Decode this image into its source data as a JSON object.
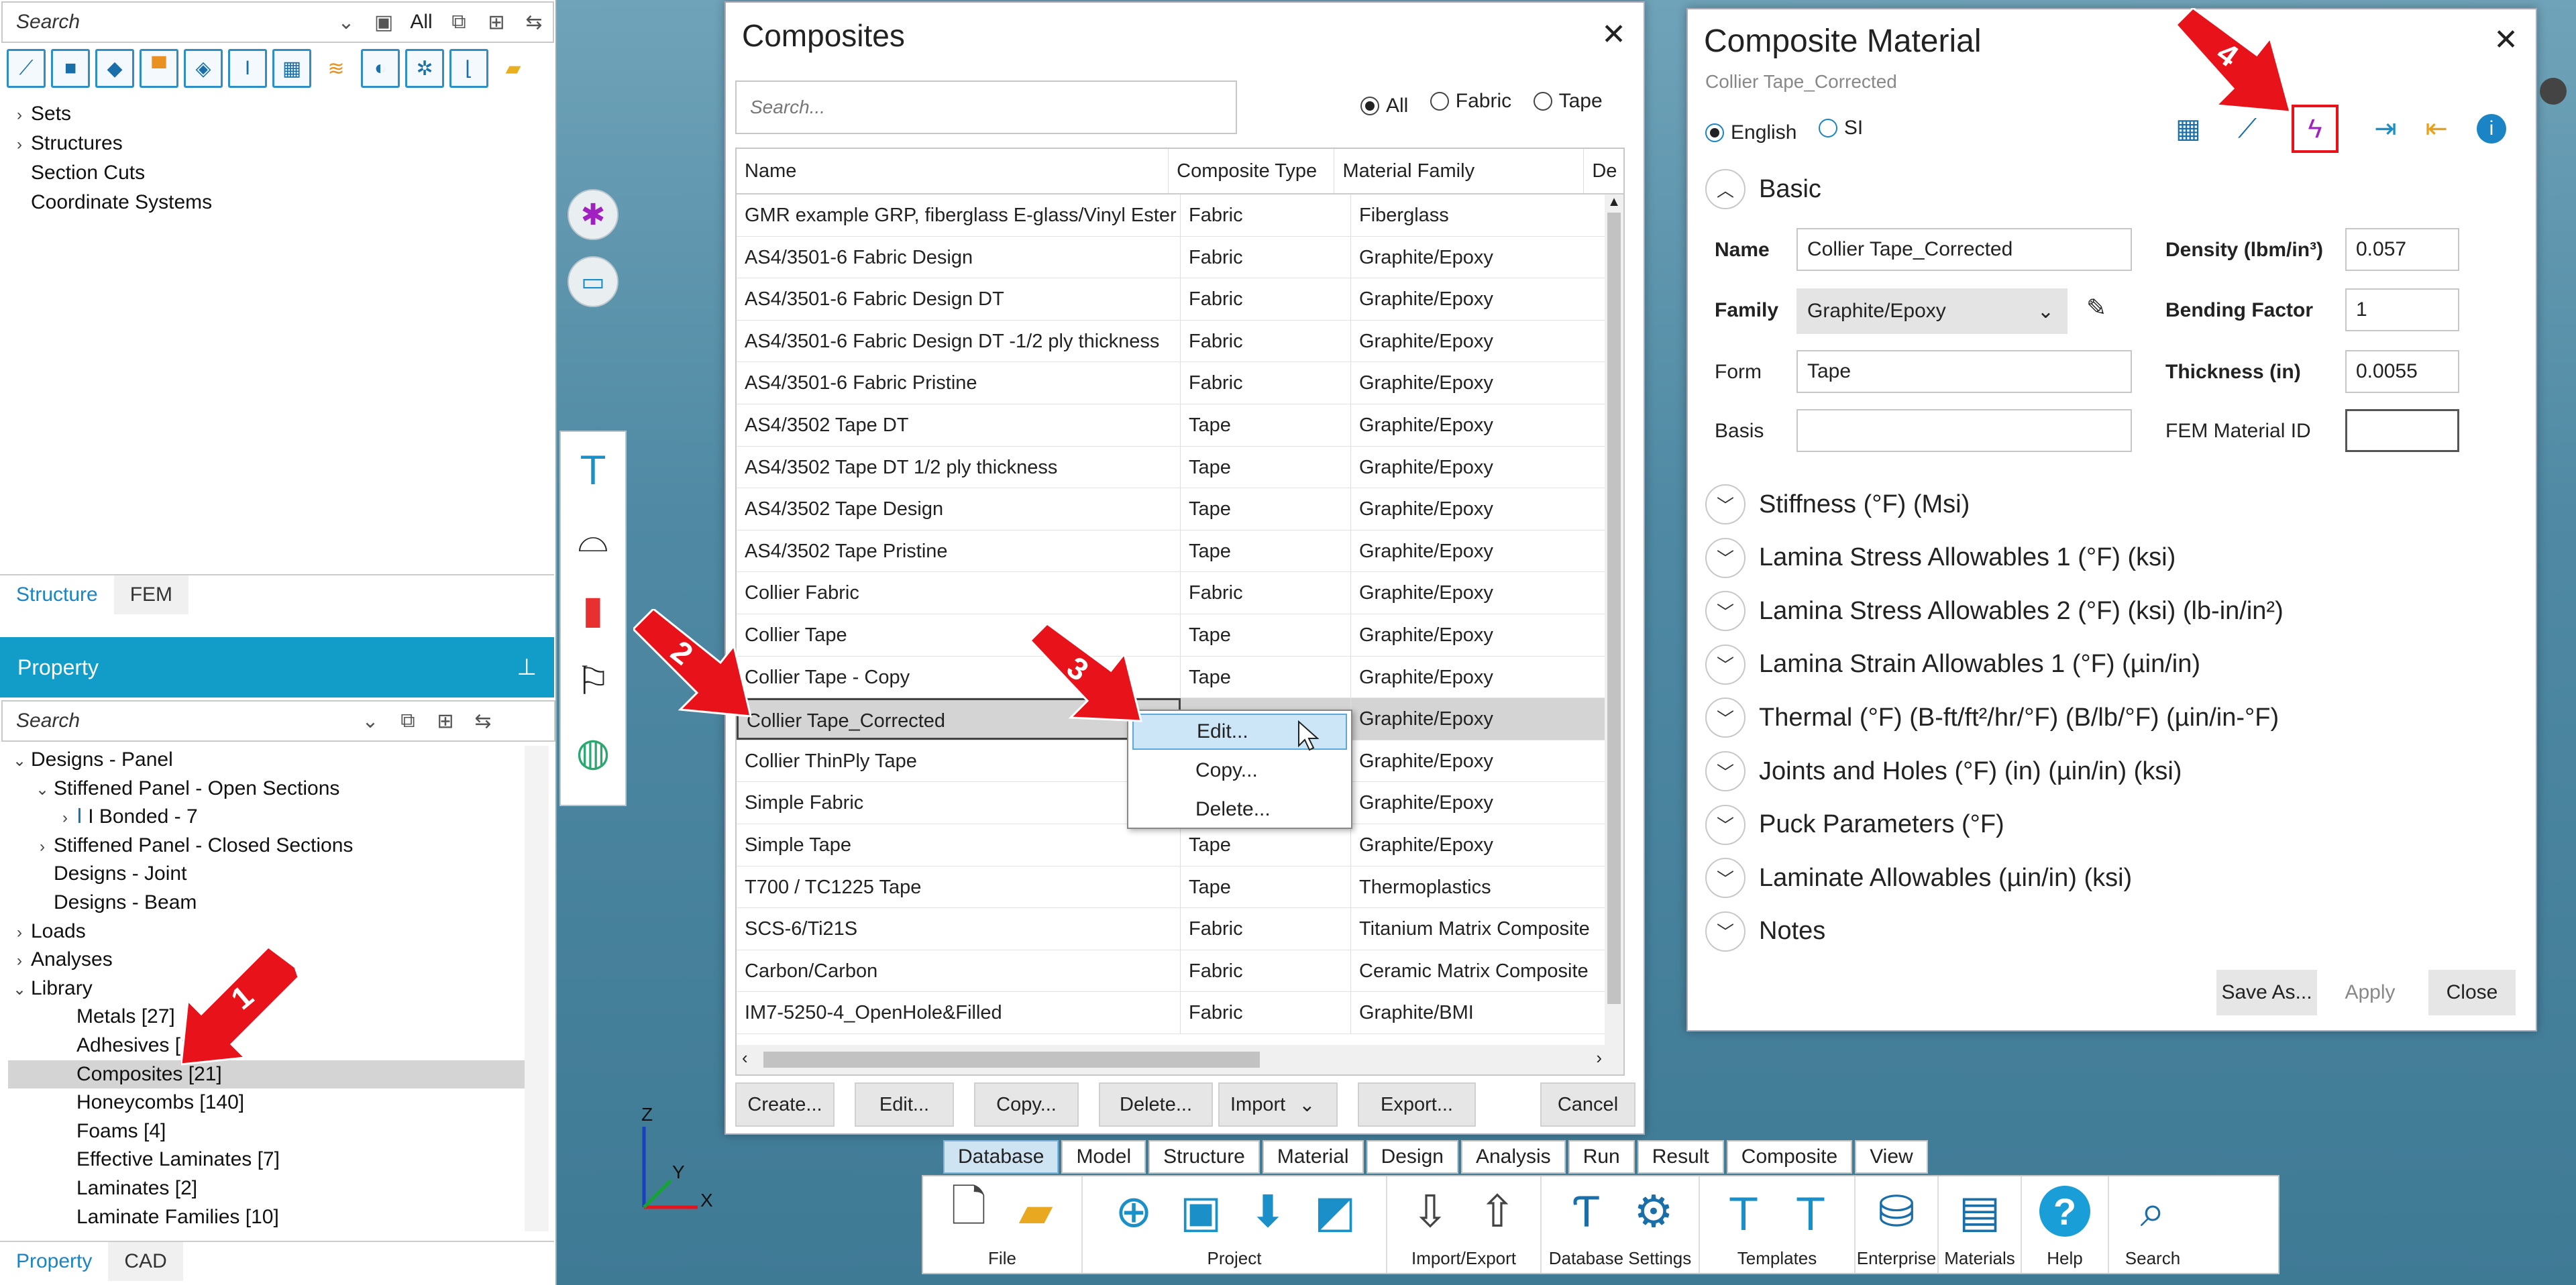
{
  "left_panel": {
    "search_placeholder": "Search",
    "filter_all": "All",
    "tree_top": [
      "Sets",
      "Structures",
      "Section Cuts",
      "Coordinate Systems"
    ],
    "tabs_top": [
      "Structure",
      "FEM"
    ],
    "property_title": "Property",
    "property_search": "Search",
    "property_tree": [
      {
        "label": "Designs - Panel",
        "indent": 0,
        "caret": "⌄"
      },
      {
        "label": "Stiffened Panel - Open Sections",
        "indent": 1,
        "caret": "⌄"
      },
      {
        "label": "I Bonded - 7",
        "indent": 2,
        "caret": "›",
        "icon": "I"
      },
      {
        "label": "Stiffened Panel - Closed Sections",
        "indent": 1,
        "caret": "›"
      },
      {
        "label": "Designs - Joint",
        "indent": 1,
        "caret": ""
      },
      {
        "label": "Designs - Beam",
        "indent": 1,
        "caret": ""
      },
      {
        "label": "Loads",
        "indent": 0,
        "caret": "›"
      },
      {
        "label": "Analyses",
        "indent": 0,
        "caret": "›"
      },
      {
        "label": "Library",
        "indent": 0,
        "caret": "⌄"
      },
      {
        "label": "Metals [27]",
        "indent": 2,
        "caret": ""
      },
      {
        "label": "Adhesives [1]",
        "indent": 2,
        "caret": ""
      },
      {
        "label": "Composites [21]",
        "indent": 2,
        "caret": "",
        "selected": true
      },
      {
        "label": "Honeycombs [140]",
        "indent": 2,
        "caret": ""
      },
      {
        "label": "Foams [4]",
        "indent": 2,
        "caret": ""
      },
      {
        "label": "Effective Laminates [7]",
        "indent": 2,
        "caret": ""
      },
      {
        "label": "Laminates [2]",
        "indent": 2,
        "caret": ""
      },
      {
        "label": "Laminate Families [10]",
        "indent": 2,
        "caret": ""
      }
    ],
    "tabs_bottom": [
      "Property",
      "CAD"
    ]
  },
  "composites_dialog": {
    "title": "Composites",
    "search_placeholder": "Search...",
    "filters": [
      {
        "label": "All",
        "selected": true
      },
      {
        "label": "Fabric",
        "selected": false
      },
      {
        "label": "Tape",
        "selected": false
      }
    ],
    "columns": [
      "Name",
      "Composite Type",
      "Material Family",
      "De"
    ],
    "rows": [
      [
        "GMR example GRP, fiberglass E-glass/Vinyl Ester",
        "Fabric",
        "Fiberglass"
      ],
      [
        "AS4/3501-6 Fabric Design",
        "Fabric",
        "Graphite/Epoxy"
      ],
      [
        "AS4/3501-6 Fabric Design DT",
        "Fabric",
        "Graphite/Epoxy"
      ],
      [
        "AS4/3501-6 Fabric Design DT -1/2 ply thickness",
        "Fabric",
        "Graphite/Epoxy"
      ],
      [
        "AS4/3501-6 Fabric Pristine",
        "Fabric",
        "Graphite/Epoxy"
      ],
      [
        "AS4/3502 Tape DT",
        "Tape",
        "Graphite/Epoxy"
      ],
      [
        "AS4/3502 Tape DT 1/2 ply thickness",
        "Tape",
        "Graphite/Epoxy"
      ],
      [
        "AS4/3502 Tape Design",
        "Tape",
        "Graphite/Epoxy"
      ],
      [
        "AS4/3502 Tape Pristine",
        "Tape",
        "Graphite/Epoxy"
      ],
      [
        "Collier Fabric",
        "Fabric",
        "Graphite/Epoxy"
      ],
      [
        "Collier Tape",
        "Tape",
        "Graphite/Epoxy"
      ],
      [
        "Collier Tape - Copy",
        "Tape",
        "Graphite/Epoxy"
      ],
      [
        "Collier Tape_Corrected",
        "",
        "Graphite/Epoxy"
      ],
      [
        "Collier ThinPly Tape",
        "",
        "Graphite/Epoxy"
      ],
      [
        "Simple Fabric",
        "",
        "Graphite/Epoxy"
      ],
      [
        "Simple Tape",
        "Tape",
        "Graphite/Epoxy"
      ],
      [
        "T700 / TC1225 Tape",
        "Tape",
        "Thermoplastics"
      ],
      [
        "SCS-6/Ti21S",
        "Fabric",
        "Titanium Matrix Composite"
      ],
      [
        "Carbon/Carbon",
        "Fabric",
        "Ceramic Matrix Composite"
      ],
      [
        "IM7-5250-4_OpenHole&Filled",
        "Fabric",
        "Graphite/BMI"
      ]
    ],
    "selected_row": 12,
    "buttons": [
      "Create...",
      "Edit...",
      "Copy...",
      "Delete...",
      "Import",
      "Export...",
      "Cancel"
    ]
  },
  "context_menu": {
    "items": [
      "Edit...",
      "Copy...",
      "Delete..."
    ],
    "hover_index": 0
  },
  "material_dialog": {
    "title": "Composite Material",
    "subtitle": "Collier Tape_Corrected",
    "units": [
      {
        "label": "English",
        "selected": true
      },
      {
        "label": "SI",
        "selected": false
      }
    ],
    "basic_title": "Basic",
    "fields": {
      "name_label": "Name",
      "name_value": "Collier Tape_Corrected",
      "family_label": "Family",
      "family_value": "Graphite/Epoxy",
      "form_label": "Form",
      "form_value": "Tape",
      "basis_label": "Basis",
      "basis_value": "",
      "density_label": "Density (lbm/in³)",
      "density_value": "0.057",
      "bending_label": "Bending Factor",
      "bending_value": "1",
      "thickness_label": "Thickness (in)",
      "thickness_value": "0.0055",
      "fem_label": "FEM Material ID",
      "fem_value": ""
    },
    "sections": [
      "Stiffness (°F) (Msi)",
      "Lamina Stress Allowables 1 (°F) (ksi)",
      "Lamina Stress Allowables 2 (°F) (ksi) (lb-in/in²)",
      "Lamina Strain Allowables 1 (°F) (µin/in)",
      "Thermal (°F) (B-ft/ft²/hr/°F) (B/lb/°F) (µin/in-°F)",
      "Joints and Holes (°F) (in) (µin/in) (ksi)",
      "Puck Parameters (°F)",
      "Laminate Allowables (µin/in) (ksi)",
      "Notes"
    ],
    "buttons": [
      "Save As...",
      "Apply",
      "Close"
    ]
  },
  "ribbon": {
    "tabs": [
      "Database",
      "Model",
      "Structure",
      "Material",
      "Design",
      "Analysis",
      "Run",
      "Result",
      "Composite",
      "View"
    ],
    "active_tab": "Database",
    "groups": [
      "File",
      "Project",
      "Import/Export",
      "Database Settings",
      "Templates",
      "Enterprise",
      "Materials",
      "Help",
      "Search"
    ]
  },
  "axes": {
    "z": "Z",
    "y": "Y",
    "x": "X"
  },
  "annotations": [
    "1",
    "2",
    "3",
    "4"
  ],
  "colors": {
    "accent": "#119dc8",
    "arrow": "#e8121b",
    "highlight": "#e8121b"
  }
}
